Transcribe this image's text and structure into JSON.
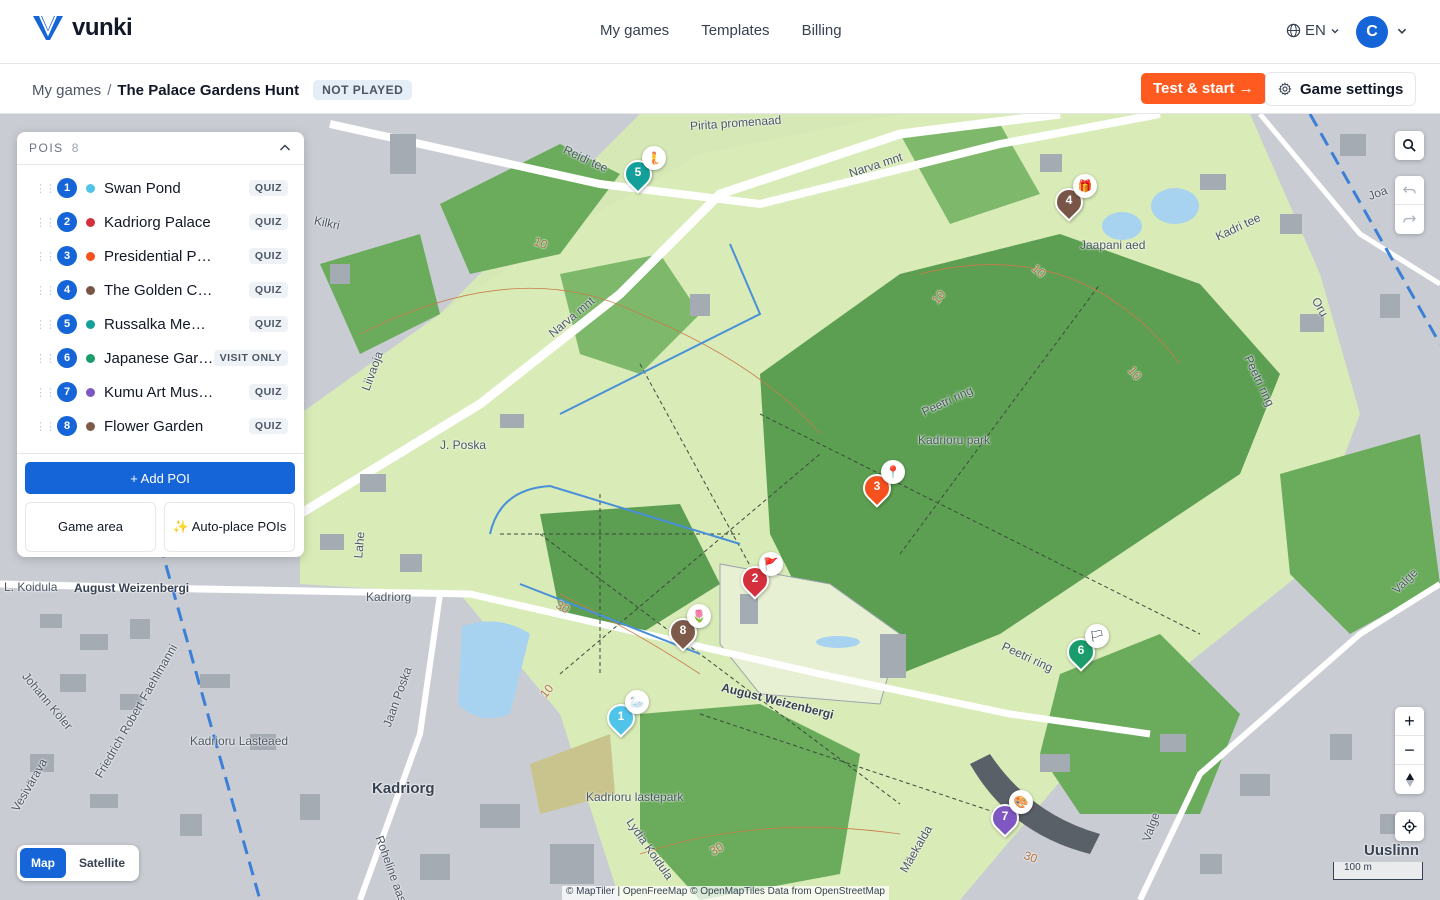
{
  "brand": {
    "name": "vunki"
  },
  "nav": {
    "links": [
      "My games",
      "Templates",
      "Billing"
    ],
    "language": "EN",
    "avatar_initial": "C"
  },
  "breadcrumb": {
    "parent": "My games",
    "separator": "/",
    "current": "The Palace Gardens Hunt",
    "status": "NOT PLAYED"
  },
  "actions": {
    "test_start": "Test & start →",
    "game_settings": "Game settings"
  },
  "poi_panel": {
    "title": "POIS",
    "count": "8",
    "items": [
      {
        "number": "1",
        "name": "Swan Pond",
        "type": "QUIZ",
        "color": "#4fc3e8"
      },
      {
        "number": "2",
        "name": "Kadriorg Palace",
        "type": "QUIZ",
        "color": "#d32f3c"
      },
      {
        "number": "3",
        "name": "Presidential Palace",
        "type": "QUIZ",
        "color": "#f4511e"
      },
      {
        "number": "4",
        "name": "The Golden Chest",
        "type": "QUIZ",
        "color": "#795548"
      },
      {
        "number": "5",
        "name": "Russalka Memorial",
        "type": "QUIZ",
        "color": "#14a09a"
      },
      {
        "number": "6",
        "name": "Japanese Gard...",
        "type": "VISIT ONLY",
        "color": "#1a9c6b"
      },
      {
        "number": "7",
        "name": "Kumu Art Museum",
        "type": "QUIZ",
        "color": "#7e57c2"
      },
      {
        "number": "8",
        "name": "Flower Garden",
        "type": "QUIZ",
        "color": "#7d5a4a"
      }
    ],
    "add_label": "+ Add POI",
    "game_area_label": "Game area",
    "auto_place_label": "✨ Auto-place POIs"
  },
  "map": {
    "labels": {
      "pirita": "Pirita promenaad",
      "narva1": "Narva mnt",
      "narva2": "Narva mnt",
      "reidi": "Reidi tee",
      "kilkri": "Kilkri",
      "japan": "Jaapani aed",
      "kadri": "Kadri tee",
      "oru": "Oru",
      "joa": "Joa",
      "peetri1": "Peetri ring",
      "peetri2": "Peetri ring",
      "peetri3": "Peetri ring",
      "kpark": "Kadrioru park",
      "jposka": "J. Poska",
      "liivaoja": "Liivaoja",
      "lahe": "Lahe",
      "koidula": "L. Koidula",
      "weiz1": "August Weizenbergi",
      "weiz2": "August Weizenbergi",
      "kadriorg_st": "Kadriorg",
      "jaanposka": "Jaan Poska",
      "johann": "Johann Köler",
      "faehl": "Friedrich Robert Faehlmanni",
      "vesivarava": "Vesivärava",
      "lasteaed": "Kadrioru Lasteaed",
      "lastepark": "Kadrioru lastepark",
      "kadriorg_dist": "Kadriorg",
      "lydia": "Lydia Koidula",
      "maekalda": "Mäekalda",
      "valge1": "Valge",
      "valge2": "Valge",
      "uuslinn": "Uuslinn",
      "roheline": "Roheline aas"
    },
    "contours": [
      "10",
      "10",
      "10",
      "10",
      "30",
      "30",
      "30",
      "10"
    ],
    "toggle": {
      "map": "Map",
      "satellite": "Satellite"
    },
    "attribution": "© MapTiler | OpenFreeMap © OpenMapTiles Data from OpenStreetMap",
    "scale": "100 m",
    "zoom_in": "+",
    "zoom_out": "−"
  },
  "markers": [
    {
      "number": "5",
      "color": "#14a09a",
      "badge": "🧜"
    },
    {
      "number": "4",
      "color": "#795548",
      "badge": "🎁"
    },
    {
      "number": "3",
      "color": "#f4511e",
      "badge": "📍"
    },
    {
      "number": "2",
      "color": "#d32f3c",
      "badge": "🚩"
    },
    {
      "number": "8",
      "color": "#7d5a4a",
      "badge": "🌷"
    },
    {
      "number": "6",
      "color": "#1a9c6b",
      "badge": "🏳"
    },
    {
      "number": "1",
      "color": "#4fc3e8",
      "badge": "🦢"
    },
    {
      "number": "7",
      "color": "#7e57c2",
      "badge": "🎨"
    }
  ],
  "colors": {
    "primary": "#1565d8",
    "accent": "#ff5a1f"
  }
}
